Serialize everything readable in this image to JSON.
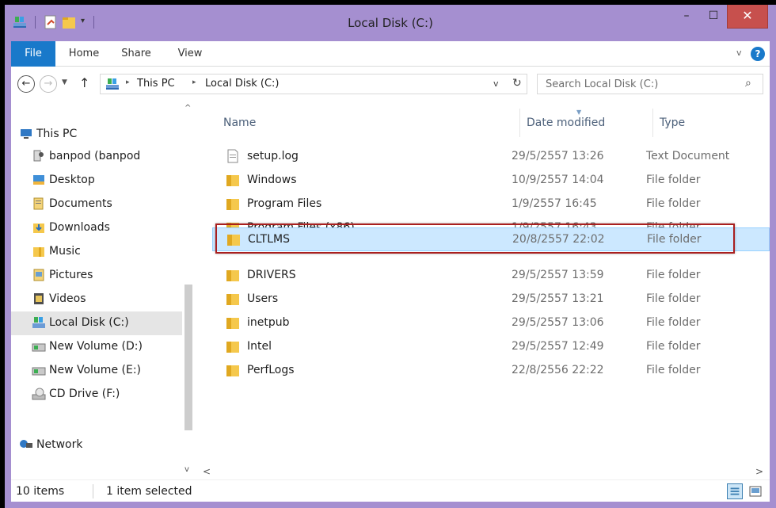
{
  "window": {
    "title": "Local Disk (C:)",
    "close_glyph": "✕",
    "min_glyph": "–",
    "max_glyph": "☐"
  },
  "ribbon": {
    "tabs": [
      "File",
      "Home",
      "Share",
      "View"
    ],
    "collapse_glyph": "v",
    "help_glyph": "?"
  },
  "address": {
    "back_glyph": "←",
    "forward_glyph": "→",
    "recent_glyph": "▼",
    "up_glyph": "↑",
    "crumbs": [
      "This PC",
      "Local Disk (C:)"
    ],
    "crumb_sep": "▸",
    "dropdown_glyph": "v",
    "refresh_glyph": "↻"
  },
  "search": {
    "placeholder": "Search Local Disk (C:)",
    "icon_glyph": "⌕"
  },
  "nav_pane": {
    "scroll_up": "^",
    "scroll_down": "v",
    "items": [
      {
        "label": "This PC",
        "icon": "pc-icon"
      },
      {
        "label": "banpod (banpod",
        "icon": "user-icon"
      },
      {
        "label": "Desktop",
        "icon": "desktop-icon"
      },
      {
        "label": "Documents",
        "icon": "documents-icon"
      },
      {
        "label": "Downloads",
        "icon": "downloads-icon"
      },
      {
        "label": "Music",
        "icon": "music-icon"
      },
      {
        "label": "Pictures",
        "icon": "pictures-icon"
      },
      {
        "label": "Videos",
        "icon": "videos-icon"
      },
      {
        "label": "Local Disk (C:)",
        "icon": "drive-icon"
      },
      {
        "label": "New Volume (D:)",
        "icon": "volume-icon"
      },
      {
        "label": "New Volume (E:)",
        "icon": "volume-icon"
      },
      {
        "label": "CD Drive (F:)",
        "icon": "cd-drive-icon"
      },
      {
        "label": "Network",
        "icon": "network-icon"
      }
    ]
  },
  "columns": {
    "name": "Name",
    "date": "Date modified",
    "type": "Type"
  },
  "files": [
    {
      "name": "setup.log",
      "date": "29/5/2557 13:26",
      "type": "Text Document",
      "icon": "text-file-icon"
    },
    {
      "name": "Windows",
      "date": "10/9/2557 14:04",
      "type": "File folder",
      "icon": "folder-icon"
    },
    {
      "name": "Program Files",
      "date": "1/9/2557 16:45",
      "type": "File folder",
      "icon": "folder-icon"
    },
    {
      "name": "Program Files (x86)",
      "date": "1/9/2557 16:43",
      "type": "File folder",
      "icon": "folder-icon"
    },
    {
      "name": "CLTLMS",
      "date": "20/8/2557 22:02",
      "type": "File folder",
      "icon": "folder-icon"
    },
    {
      "name": "DRIVERS",
      "date": "29/5/2557 13:59",
      "type": "File folder",
      "icon": "folder-icon"
    },
    {
      "name": "Users",
      "date": "29/5/2557 13:21",
      "type": "File folder",
      "icon": "folder-icon"
    },
    {
      "name": "inetpub",
      "date": "29/5/2557 13:06",
      "type": "File folder",
      "icon": "folder-icon"
    },
    {
      "name": "Intel",
      "date": "29/5/2557 12:49",
      "type": "File folder",
      "icon": "folder-icon"
    },
    {
      "name": "PerfLogs",
      "date": "22/8/2556 22:22",
      "type": "File folder",
      "icon": "folder-icon"
    }
  ],
  "hscroll": {
    "left": "<",
    "right": ">"
  },
  "status": {
    "count": "10 items",
    "selected": "1 item selected"
  },
  "colors": {
    "titlebar": "#a58fd0",
    "accent": "#1979ca",
    "selection": "#cce8ff",
    "highlight_box": "#a91f1f",
    "close": "#c7504d"
  }
}
